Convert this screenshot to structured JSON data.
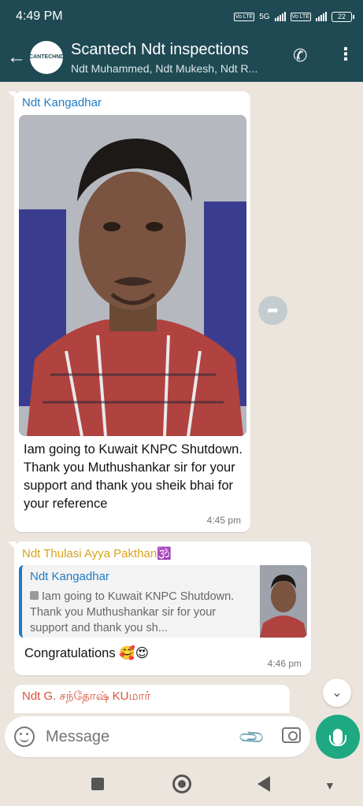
{
  "status_bar": {
    "time": "4:49 PM",
    "network": "5G",
    "battery": "22"
  },
  "header": {
    "back_icon": "arrow-back-icon",
    "group_avatar_text": "SCANTECHNDT",
    "title": "Scantech Ndt inspections",
    "subtitle": "Ndt Muhammed,  Ndt Mukesh,  Ndt R...",
    "call_icon": "add-call-icon",
    "menu_icon": "more-vert-icon"
  },
  "messages": [
    {
      "sender": "Ndt Kangadhar",
      "text": "Iam going to Kuwait KNPC Shutdown. Thank you Muthushankar sir for your support and thank you sheik bhai for your reference",
      "time": "4:45 pm",
      "has_image": true
    },
    {
      "sender": "Ndt Thulasi Ayya Pakthan🕉️",
      "quote": {
        "sender": "Ndt Kangadhar",
        "text": "Iam going to Kuwait KNPC Shutdown. Thank you Muthushankar sir for your support and thank you sh..."
      },
      "text": "Congratulations 🥰😍",
      "time": "4:46 pm"
    },
    {
      "sender": "Ndt G. சந்தோஷ் KUமார்"
    }
  ],
  "input": {
    "placeholder": "Message"
  },
  "colors": {
    "header": "#1f4a54",
    "chat_bg": "#ece5dd",
    "accent": "#1ea982"
  }
}
